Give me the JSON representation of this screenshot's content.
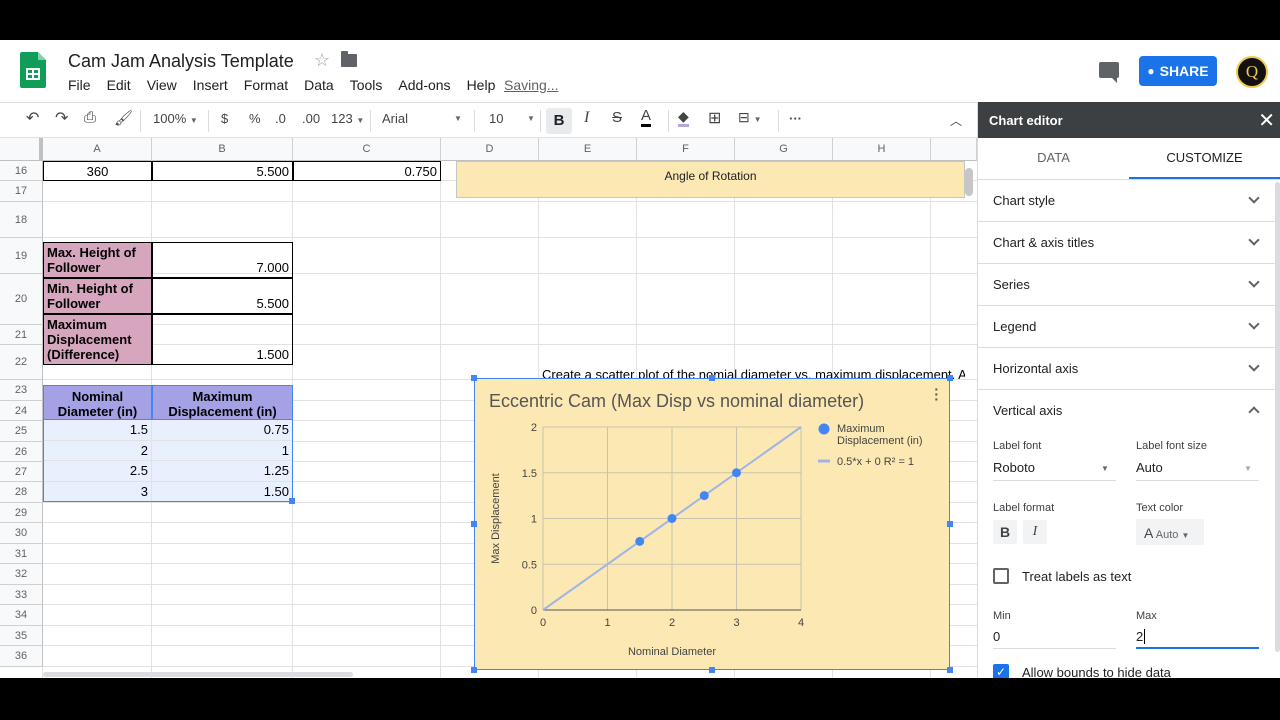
{
  "header": {
    "title": "Cam Jam Analysis Template",
    "menu": [
      "File",
      "Edit",
      "View",
      "Insert",
      "Format",
      "Data",
      "Tools",
      "Add-ons",
      "Help"
    ],
    "status": "Saving...",
    "share_label": "SHARE",
    "avatar_letter": "Q"
  },
  "toolbar": {
    "zoom": "100%",
    "currency": "$",
    "percent": "%",
    "dec_less": ".0",
    "dec_more": ".00",
    "more_formats": "123",
    "font": "Arial",
    "font_size": "10",
    "bold": "B",
    "italic": "I",
    "strike": "S",
    "text_color": "A",
    "more": "···"
  },
  "grid": {
    "columns": [
      "A",
      "B",
      "C",
      "D",
      "E",
      "F",
      "G",
      "H"
    ],
    "rows": [
      "16",
      "17",
      "18",
      "19",
      "20",
      "21",
      "22",
      "23",
      "24",
      "25",
      "26",
      "27",
      "28",
      "29",
      "30",
      "31",
      "32",
      "33",
      "34",
      "35",
      "36"
    ],
    "r16": {
      "a": "360",
      "b": "5.500",
      "c": "0.750"
    },
    "angle_label": "Angle of Rotation",
    "r18": {
      "a": "Max. Height of Follower",
      "b": "7.000"
    },
    "r19": {
      "a": "Min. Height of Follower",
      "b": "5.500"
    },
    "r20": {
      "a": "Maximum Displacement (Difference)",
      "b": "1.500"
    },
    "instruction": "Create a scatter plot of the nomial diameter vs. maximum displacement. Add",
    "hdr_a": "Nominal Diameter (in)",
    "hdr_b": "Maximum Displacement (in)",
    "data_rows": [
      {
        "a": "1.5",
        "b": "0.75"
      },
      {
        "a": "2",
        "b": "1"
      },
      {
        "a": "2.5",
        "b": "1.25"
      },
      {
        "a": "3",
        "b": "1.50"
      }
    ]
  },
  "chart_data": {
    "type": "scatter",
    "title": "Eccentric Cam (Max Disp vs nominal diameter)",
    "xlabel": "Nominal Diameter",
    "ylabel": "Max Displacement",
    "xlim": [
      0,
      4
    ],
    "ylim": [
      0,
      2
    ],
    "x_ticks": [
      "0",
      "1",
      "2",
      "3",
      "4"
    ],
    "y_ticks": [
      "0",
      "0.5",
      "1",
      "1.5",
      "2"
    ],
    "grid": true,
    "legend_position": "right",
    "series": [
      {
        "name": "Maximum Displacement (in)",
        "x": [
          1.5,
          2,
          2.5,
          3
        ],
        "y": [
          0.75,
          1,
          1.25,
          1.5
        ],
        "color": "#4285f4"
      }
    ],
    "trendline": {
      "name": "0.5*x + 0 R² = 1",
      "slope": 0.5,
      "intercept": 0,
      "color": "#a0b4e8"
    }
  },
  "editor": {
    "title": "Chart editor",
    "tabs": [
      "DATA",
      "CUSTOMIZE"
    ],
    "sections": [
      "Chart style",
      "Chart & axis titles",
      "Series",
      "Legend",
      "Horizontal axis",
      "Vertical axis"
    ],
    "label_font_label": "Label font",
    "label_font": "Roboto",
    "label_size_label": "Label font size",
    "label_size": "Auto",
    "label_format_label": "Label format",
    "fmt_bold": "B",
    "fmt_italic": "I",
    "text_color_label": "Text color",
    "text_color_a": "A",
    "text_color_value": "Auto",
    "treat_labels": "Treat labels as text",
    "min_label": "Min",
    "min_value": "0",
    "max_label": "Max",
    "max_value": "2",
    "allow_bounds": "Allow bounds to hide data"
  }
}
